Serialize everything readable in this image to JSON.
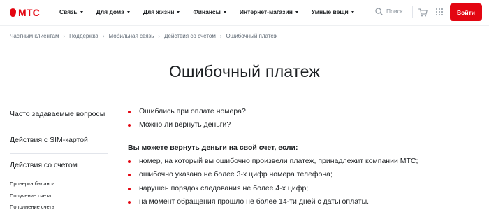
{
  "header": {
    "logo_text": "МТС",
    "nav": [
      {
        "label": "Связь"
      },
      {
        "label": "Для дома"
      },
      {
        "label": "Для жизни"
      },
      {
        "label": "Финансы"
      },
      {
        "label": "Интернет-магазин"
      },
      {
        "label": "Умные вещи"
      }
    ],
    "search_label": "Поиск",
    "login_label": "Войти"
  },
  "breadcrumb": [
    "Частным клиентам",
    "Поддержка",
    "Мобильная связь",
    "Действия со счетом",
    "Ошибочный платеж"
  ],
  "breadcrumb_separator": "›",
  "page_title": "Ошибочный платеж",
  "sidebar": {
    "sections": [
      "Часто задаваемые вопросы",
      "Действия с SIM-картой",
      "Действия со счетом"
    ],
    "subitems": [
      "Проверка баланса",
      "Получение счета",
      "Пополнение счета"
    ]
  },
  "content": {
    "questions": [
      "Ошиблись при оплате номера?",
      "Можно ли вернуть деньги?"
    ],
    "subtitle": "Вы можете вернуть деньги на свой счет, если:",
    "conditions": [
      "номер, на который вы ошибочно произвели платеж, принадлежит компании МТС;",
      "ошибочно указано не более 3-х цифр номера телефона;",
      "нарушен порядок следования не более 4-х цифр;",
      "на момент обращения прошло не более 14-ти дней с даты оплаты."
    ]
  },
  "colors": {
    "brand": "#e30611",
    "text": "#1d2023",
    "muted": "#626c77",
    "divider": "#e2e5eb"
  },
  "icons": [
    "search-icon",
    "cart-icon",
    "apps-grid-icon",
    "chevron-down-icon"
  ]
}
